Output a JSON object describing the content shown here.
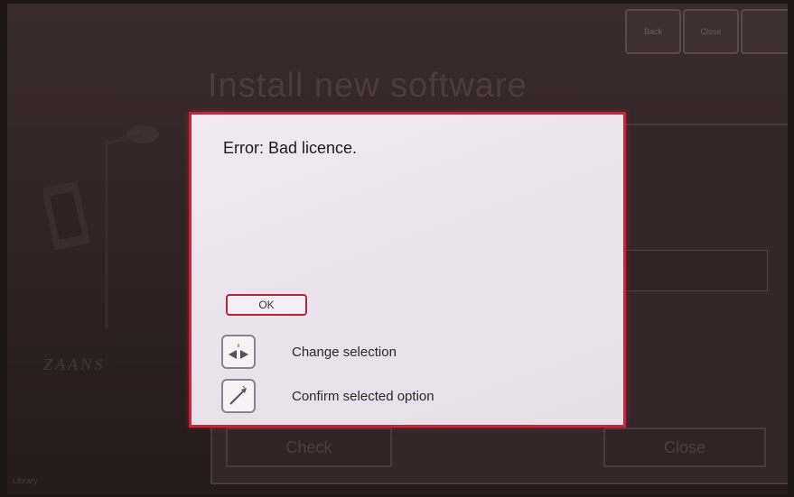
{
  "background": {
    "title": "Install new software",
    "top_buttons": [
      "Back",
      "Close",
      ""
    ],
    "check_button": "Check",
    "close_button": "Close",
    "logo_text": "ZAANS",
    "corner_text": "Library"
  },
  "dialog": {
    "message": "Error: Bad licence.",
    "ok_label": "OK",
    "help": [
      {
        "icon": "left-right-arrows-icon",
        "label": "Change selection"
      },
      {
        "icon": "confirm-pen-icon",
        "label": "Confirm selected option"
      }
    ]
  },
  "colors": {
    "accent": "#c4263c",
    "dialog_bg": "#ece4ed",
    "backdrop": "#2d2123"
  }
}
